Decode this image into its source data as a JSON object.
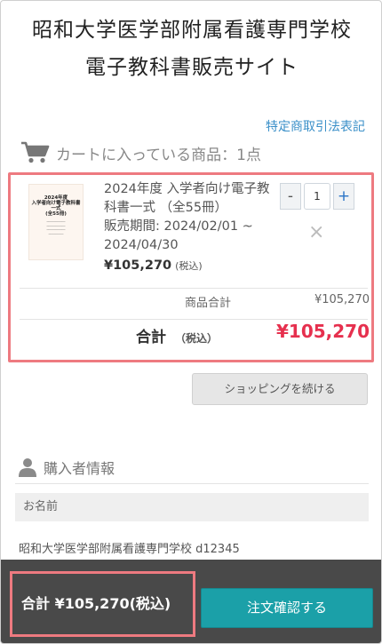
{
  "site": {
    "title_line1": "昭和大学医学部附属看護専門学校",
    "title_line2": "電子教科書販売サイト"
  },
  "legal_link": "特定商取引法表記",
  "cart": {
    "heading": "カートに入っている商品：1点",
    "item": {
      "thumbnail": {
        "line1": "2024年度",
        "line2": "入学者向け電子教科書一式",
        "line3": "(全55冊)"
      },
      "title": "2024年度 入学者向け電子教科書一式 （全55冊）",
      "sales_period": "販売期間: 2024/02/01 ~ 2024/04/30",
      "price": "¥105,270",
      "tax_note": "(税込)",
      "quantity": "1",
      "minus_label": "-",
      "plus_label": "+",
      "remove_label": "×"
    },
    "subtotal_label": "商品合計",
    "subtotal_value": "¥105,270",
    "total_label": "合計",
    "total_tax_note": "（税込）",
    "total_value": "¥105,270",
    "accent_color": "#e6304e"
  },
  "continue_button": "ショッピングを続ける",
  "buyer": {
    "heading": "購入者情報",
    "name_label": "お名前",
    "name_value": "昭和大学医学部附属看護専門学校 d12345"
  },
  "footer": {
    "total_text": "合計 ¥105,270(税込)",
    "confirm_button": "注文確認する",
    "confirm_color": "#1ba0a8"
  }
}
